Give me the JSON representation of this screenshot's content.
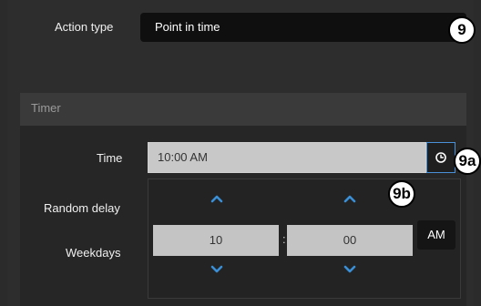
{
  "action": {
    "label": "Action type",
    "value": "Point in time",
    "marker": "9"
  },
  "timer": {
    "header": "Timer",
    "time_label": "Time",
    "time_value": "10:00 AM",
    "clock_icon": "clock-icon",
    "marker_button": "9a",
    "marker_picker": "9b",
    "random_delay_label": "Random delay",
    "weekdays_label": "Weekdays"
  },
  "picker": {
    "hours": "10",
    "separator": ":",
    "minutes": "00",
    "period": "AM",
    "increment_icon": "chevron-up-icon",
    "decrement_icon": "chevron-down-icon"
  },
  "colors": {
    "accent": "#4a90d9",
    "chevron": "#3a8fd6",
    "field": "#c4c4c4",
    "background": "#2d2d2d"
  }
}
